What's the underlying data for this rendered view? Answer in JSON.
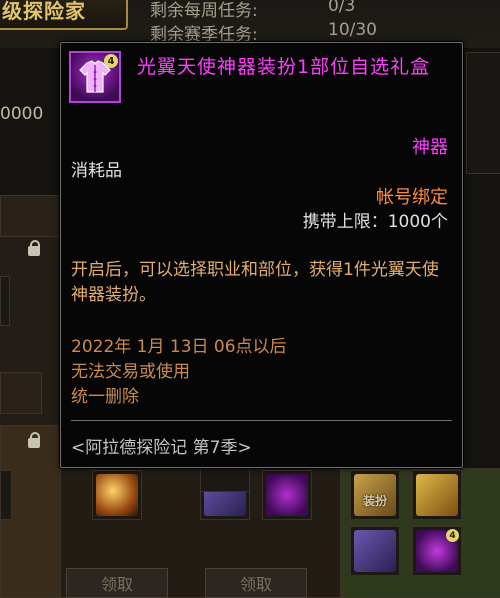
{
  "background": {
    "title_fragment": "级探险家",
    "stats": [
      {
        "label": "剩余每周任务:",
        "value": "0/3"
      },
      {
        "label": "剩余赛季任务:",
        "value": "10/30"
      }
    ],
    "left_number": "0000",
    "claim_label": "领取",
    "cloth_label": "装扮",
    "badge_value": "4"
  },
  "tooltip": {
    "item_name": "光翼天使神器装扮1部位自选礼盒",
    "icon_badge": "4",
    "rarity": "神器",
    "category": "消耗品",
    "binding": "帐号绑定",
    "carry_limit": "携带上限：1000个",
    "description": "开启后，可以选择职业和部位，获得1件光翼天使神器装扮。",
    "expire_lines": [
      "2022年 1月 13日 06点以后",
      "无法交易或使用",
      "统一删除"
    ],
    "season": "<阿拉德探险记 第7季>"
  },
  "colors": {
    "artifact_pink": "#ff3cff",
    "binding_orange": "#ff8c3a",
    "description_gold": "#e3ad6e",
    "tooltip_border": "#6e6e6e"
  },
  "icons": [
    "costume-box-icon",
    "lock-icon"
  ]
}
